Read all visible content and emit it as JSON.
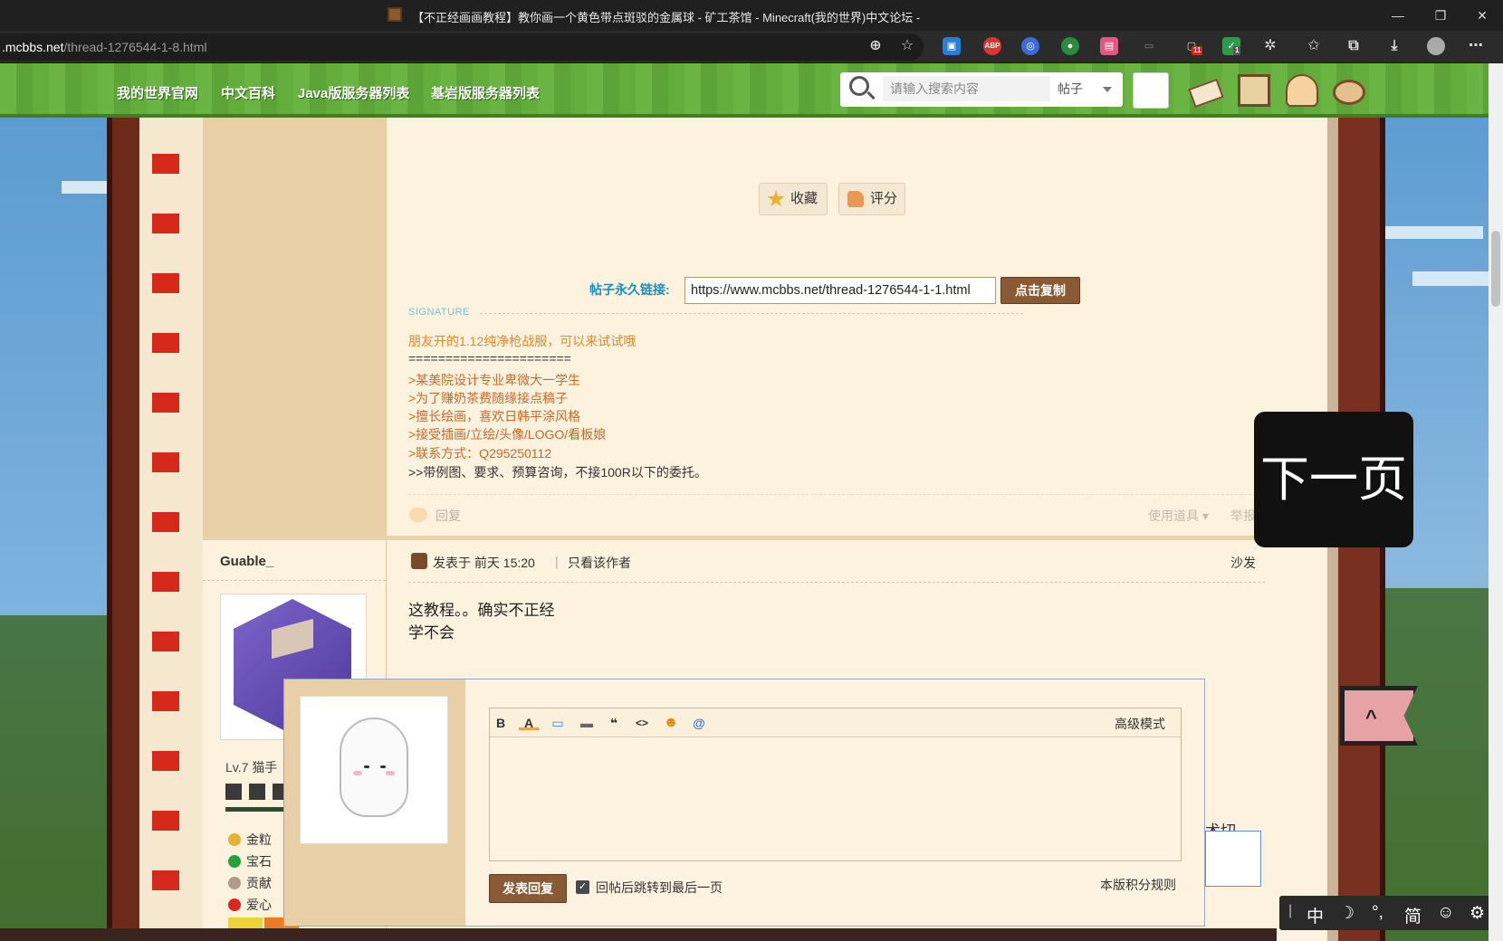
{
  "browser": {
    "title": "【不正经画画教程】教你画一个黄色带点斑驳的金属球 - 矿工茶馆 - Minecraft(我的世界)中文论坛 -",
    "url_host": ".mcbbs.net",
    "url_path": "/thread-1276544-1-8.html",
    "minimize_label": "—",
    "restore_label": "❐",
    "close_label": "✕",
    "ext_badge_1": "11",
    "ext_badge_2": "1"
  },
  "nav": {
    "links": [
      "我的世界官网",
      "中文百科",
      "Java版服务器列表",
      "基岩版服务器列表"
    ],
    "search_placeholder": "请输入搜索内容",
    "search_scope": "帖子"
  },
  "post1": {
    "fav_label": "收藏",
    "rate_label": "评分",
    "permalink_label": "帖子永久链接:",
    "permalink_value": "https://www.mcbbs.net/thread-1276544-1-1.html",
    "copy_label": "点击复制",
    "signature_label": "SIGNATURE",
    "signature_lines": [
      "朋友开的1.12纯净枪战服，可以来试试哦",
      "======================",
      ">某美院设计专业卑微大一学生",
      ">为了赚奶茶费随缘接点稿子",
      ">擅长绘画，喜欢日韩平涂风格",
      ">接受插画/立绘/头像/LOGO/看板娘",
      ">联系方式：Q295250112",
      ">>带例图、要求、预算咨询，不接100R以下的委托。"
    ],
    "reply_label": "回复",
    "tools_label": "使用道具 ▾",
    "report_label": "举报"
  },
  "post2": {
    "author": "Guable_",
    "level": "Lv.7 猫手",
    "stats": [
      "金粒",
      "宝石",
      "贡献",
      "爱心"
    ],
    "posted_at": "发表于 前天 15:20",
    "separator": "|",
    "only_author": "只看该作者",
    "floor": "沙发",
    "content": [
      "这教程。。确实不正经",
      "学不会"
    ],
    "partial_text": "术切"
  },
  "quick_reply": {
    "advanced_mode": "高级模式",
    "toolbar": [
      "B",
      "A",
      "▭",
      "▬",
      "❝",
      "<>",
      "☻",
      "@"
    ],
    "submit_label": "发表回复",
    "jump_label": "回帖后跳转到最后一页",
    "rules_label": "本版积分规则"
  },
  "overlay": {
    "next_page": "下一页"
  },
  "ime": {
    "cursor": "|",
    "mode": "中",
    "moon": "☽",
    "punct": "°,",
    "variant": "简",
    "emoji": "☺",
    "settings": "⚙"
  },
  "colors": {
    "nav_green": "#5fa939",
    "page_bg": "#fcf2dd",
    "sidebar_tan": "#e8cfa5",
    "link_blue": "#1b8ec2",
    "button_brown": "#8a5a35",
    "signature_orange": "#e08b2b"
  }
}
